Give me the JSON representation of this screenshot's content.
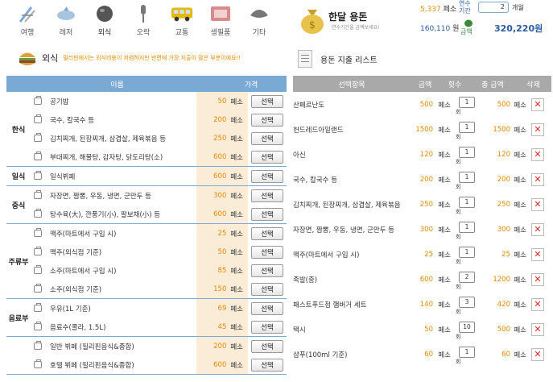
{
  "categories": [
    {
      "label": "여행",
      "icon": "beach-chair-icon"
    },
    {
      "label": "레저",
      "icon": "dolphin-icon"
    },
    {
      "label": "외식",
      "icon": "plate-dome-icon"
    },
    {
      "label": "오락",
      "icon": "microphone-icon"
    },
    {
      "label": "교통",
      "icon": "bus-icon"
    },
    {
      "label": "생필품",
      "icon": "supplies-box-icon"
    },
    {
      "label": "기타",
      "icon": "misc-icon"
    }
  ],
  "section": {
    "name": "외식",
    "desc": "필리핀에서는 외식비용이 저렴하지만 반면에 가장 지출이 많은 부분이에요!!"
  },
  "left_table": {
    "headers": {
      "name": "이름",
      "price": "가격"
    },
    "unit": "페소",
    "select_label": "선택",
    "groups": [
      {
        "name": "한식",
        "items": [
          {
            "name": "공기밥",
            "price": "50"
          },
          {
            "name": "국수, 칼국수 등",
            "price": "200"
          },
          {
            "name": "김치찌개, 된장찌개, 삼겹살, 제육볶음 등",
            "price": "250"
          },
          {
            "name": "부대찌개, 해물탕, 감자탕, 닭도리탕(소)",
            "price": "600"
          }
        ]
      },
      {
        "name": "일식",
        "items": [
          {
            "name": "일식뷔페",
            "price": "600"
          }
        ]
      },
      {
        "name": "중식",
        "items": [
          {
            "name": "자장면, 짬뽕, 우동, 냉면, 군만두 등",
            "price": "300"
          },
          {
            "name": "탕수육(大), 깐풍기(小), 팔보채(小) 등",
            "price": "600"
          }
        ]
      },
      {
        "name": "주류부",
        "items": [
          {
            "name": "맥주(마트에서 구입 시)",
            "price": "25"
          },
          {
            "name": "맥주(외식점 기준)",
            "price": "50"
          },
          {
            "name": "소주(마트에서 구입 시)",
            "price": "85"
          },
          {
            "name": "소주(외식점 기준)",
            "price": "150"
          }
        ]
      },
      {
        "name": "음료부",
        "items": [
          {
            "name": "우유(1L 기준)",
            "price": "69"
          },
          {
            "name": "음료수(콜라, 1.5L)",
            "price": "45"
          }
        ]
      },
      {
        "name": "",
        "items": [
          {
            "name": "일반 뷔페 (필리핀음식&종합)",
            "price": "200"
          },
          {
            "name": "호텔 뷔페 (필리핀음식&종합)",
            "price": "600"
          }
        ]
      }
    ]
  },
  "summary": {
    "title": "한달 용돈",
    "subtitle": "연수기간을 금액보세요!",
    "remaining": "5,337",
    "remaining_unit": "페소",
    "won": "160,110",
    "won_unit": "원",
    "period_label": "연수 기간",
    "period_value": "2",
    "period_unit": "개월",
    "amount_label": "금액",
    "total": "320,220원"
  },
  "right_section_title": "용돈 지출 리스트",
  "right_table": {
    "headers": {
      "item": "선택항목",
      "amount": "금액",
      "count": "횟수",
      "total": "총 금액",
      "delete": "삭제"
    },
    "unit": "페소",
    "count_unit": "회",
    "rows": [
      {
        "name": "산페르난도",
        "amount": "500",
        "count": "1",
        "total": "500"
      },
      {
        "name": "헌드레드아일랜드",
        "amount": "1500",
        "count": "1",
        "total": "1500"
      },
      {
        "name": "아신",
        "amount": "120",
        "count": "1",
        "total": "120"
      },
      {
        "name": "국수, 칼국수 등",
        "amount": "200",
        "count": "1",
        "total": "200"
      },
      {
        "name": "김치찌개, 된장찌개, 삼겹살, 제육볶음",
        "amount": "250",
        "count": "1",
        "total": "250"
      },
      {
        "name": "자장면, 짬뽕, 우동, 냉면, 군만두 등",
        "amount": "300",
        "count": "1",
        "total": "300"
      },
      {
        "name": "맥주(마트에서 구입 시)",
        "amount": "25",
        "count": "1",
        "total": "25"
      },
      {
        "name": "족발(중)",
        "amount": "600",
        "count": "2",
        "total": "1200"
      },
      {
        "name": "패스트푸드점 햄버거 세트",
        "amount": "140",
        "count": "3",
        "total": "420"
      },
      {
        "name": "택시",
        "amount": "50",
        "count": "10",
        "total": "500"
      },
      {
        "name": "샴푸(100ml 기준)",
        "amount": "60",
        "count": "1",
        "total": "60"
      }
    ]
  },
  "colors": {
    "header_blue": "#7aa9d4",
    "header_gray": "#a9a9a9",
    "price_orange": "#e08a00",
    "delete_red": "#dd2222"
  }
}
